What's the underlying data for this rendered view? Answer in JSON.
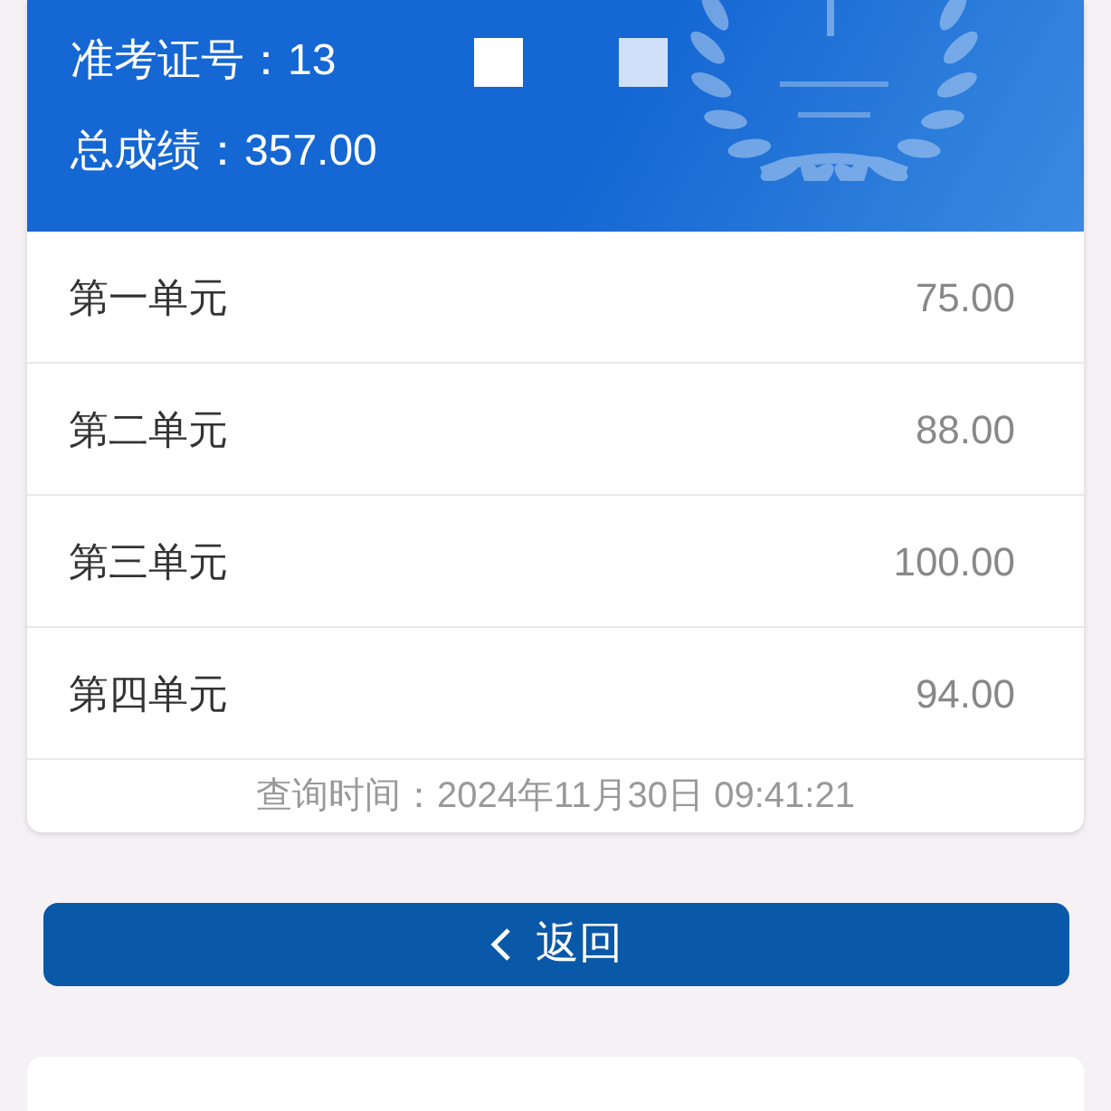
{
  "header": {
    "exam_id_label": "准考证号：",
    "exam_id_value": "13",
    "total_label": "总成绩：",
    "total_value": "357.00"
  },
  "units": [
    {
      "name": "第一单元",
      "score": "75.00"
    },
    {
      "name": "第二单元",
      "score": "88.00"
    },
    {
      "name": "第三单元",
      "score": "100.00"
    },
    {
      "name": "第四单元",
      "score": "94.00"
    }
  ],
  "query_time": "查询时间：2024年11月30日 09:41:21",
  "back_button": {
    "label": "返回"
  }
}
